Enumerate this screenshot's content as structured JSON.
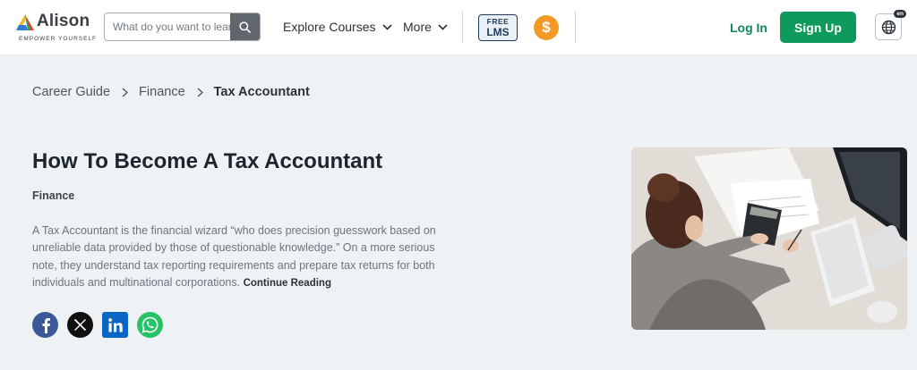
{
  "header": {
    "logo": {
      "name": "Alison",
      "tagline": "EMPOWER YOURSELF",
      "icon": "alison-logo-icon"
    },
    "search": {
      "placeholder": "What do you want to learn",
      "value": "",
      "icon": "search-icon"
    },
    "nav": {
      "explore_label": "Explore Courses",
      "more_label": "More",
      "chevron_icon": "chevron-down-icon"
    },
    "free_lms": {
      "line1": "FREE",
      "line2": "LMS"
    },
    "premium": {
      "symbol": "$",
      "icon": "dollar-icon"
    },
    "login_label": "Log In",
    "signup_label": "Sign Up",
    "language": {
      "badge": "en",
      "icon": "globe-icon"
    }
  },
  "breadcrumb": {
    "items": [
      "Career Guide",
      "Finance"
    ],
    "current": "Tax Accountant",
    "separator_icon": "chevron-right-icon"
  },
  "main": {
    "title": "How To Become A Tax Accountant",
    "category": "Finance",
    "description": "A Tax Accountant is the financial wizard “who does precision guesswork based on unreliable data provided by those of questionable knowledge.” On a more serious note, they understand tax reporting requirements and prepare tax returns for both individuals and multinational corporations.",
    "continue_label": "Continue Reading",
    "social": [
      "facebook-icon",
      "x-twitter-icon",
      "linkedin-icon",
      "whatsapp-icon"
    ],
    "hero_image": "woman-using-calculator-photo"
  },
  "colors": {
    "brand_green": "#0e9a5b",
    "page_background": "#eef2f4",
    "premium_orange": "#f39a26",
    "facebook": "#3b5998",
    "linkedin": "#0a66c2",
    "whatsapp": "#25c267"
  }
}
